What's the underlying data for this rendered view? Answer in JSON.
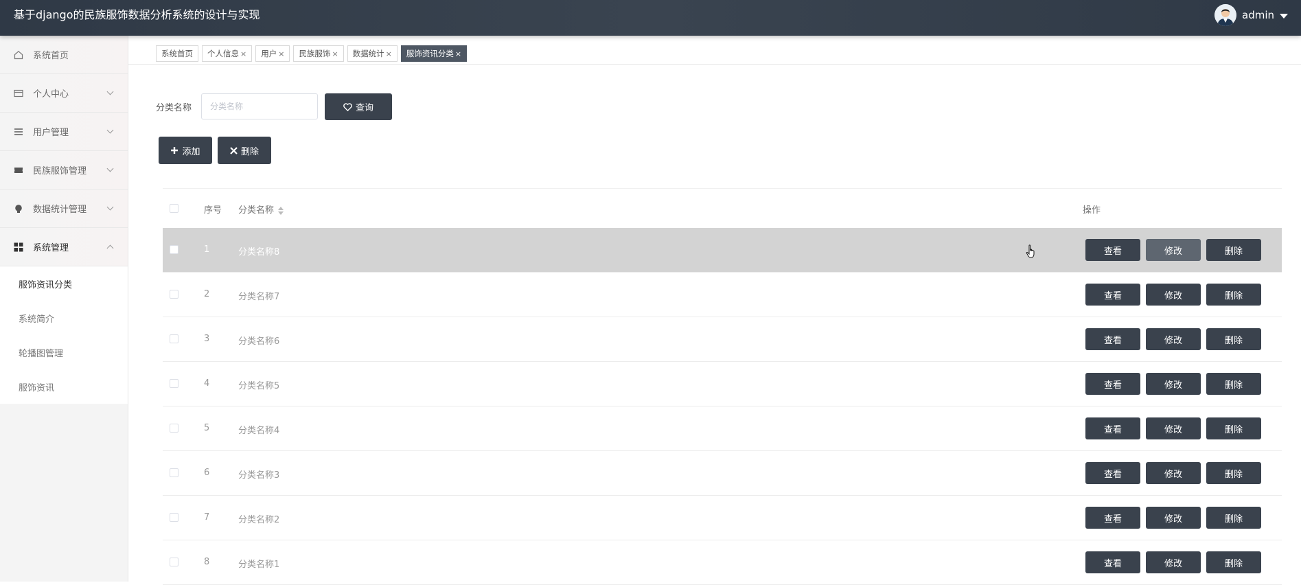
{
  "app": {
    "title": "基于django的民族服饰数据分析系统的设计与实现",
    "user": "admin"
  },
  "sidebar": {
    "items": [
      {
        "label": "系统首页",
        "icon": "home-icon"
      },
      {
        "label": "个人中心",
        "icon": "wallet-icon"
      },
      {
        "label": "用户管理",
        "icon": "list-icon"
      },
      {
        "label": "民族服饰管理",
        "icon": "ticket-icon"
      },
      {
        "label": "数据统计管理",
        "icon": "bulb-icon"
      },
      {
        "label": "系统管理",
        "icon": "grid-icon"
      }
    ],
    "subitems": [
      {
        "label": "服饰资讯分类"
      },
      {
        "label": "系统简介"
      },
      {
        "label": "轮播图管理"
      },
      {
        "label": "服饰资讯"
      }
    ]
  },
  "tabs": [
    {
      "label": "系统首页"
    },
    {
      "label": "个人信息"
    },
    {
      "label": "用户"
    },
    {
      "label": "民族服饰"
    },
    {
      "label": "数据统计"
    },
    {
      "label": "服饰资讯分类"
    }
  ],
  "close_glyph": "×",
  "filter": {
    "label": "分类名称",
    "placeholder": "分类名称",
    "query_label": "查询"
  },
  "actions": {
    "add_label": "添加",
    "delete_label": "删除"
  },
  "table": {
    "headers": {
      "index": "序号",
      "name": "分类名称",
      "ops": "操作"
    },
    "rows": [
      {
        "index": "1",
        "name": "分类名称8"
      },
      {
        "index": "2",
        "name": "分类名称7"
      },
      {
        "index": "3",
        "name": "分类名称6"
      },
      {
        "index": "4",
        "name": "分类名称5"
      },
      {
        "index": "5",
        "name": "分类名称4"
      },
      {
        "index": "6",
        "name": "分类名称3"
      },
      {
        "index": "7",
        "name": "分类名称2"
      },
      {
        "index": "8",
        "name": "分类名称1"
      }
    ],
    "row_buttons": {
      "view": "查看",
      "edit": "修改",
      "delete": "删除"
    }
  },
  "colors": {
    "header_bg": "#2f3946",
    "button_bg": "#3a424d",
    "active_tab": "#4e5763",
    "hover_row": "#d3d3d3"
  }
}
